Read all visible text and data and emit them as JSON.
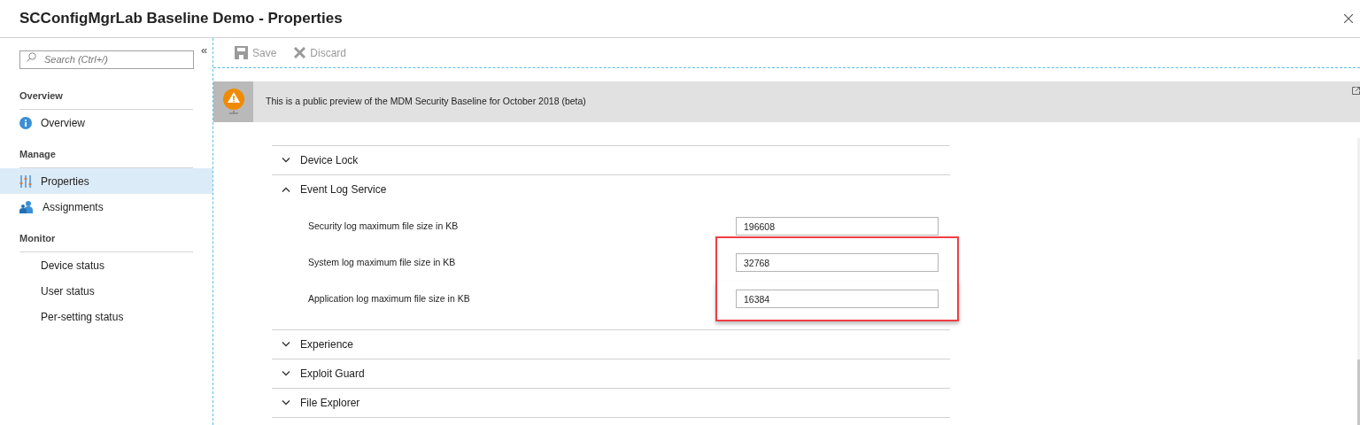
{
  "window": {
    "title": "SCConfigMgrLab Baseline Demo - Properties"
  },
  "sidebar": {
    "search": {
      "placeholder": "Search (Ctrl+/)"
    },
    "collapse_glyph": "«",
    "groups": [
      {
        "heading": "Overview",
        "items": [
          {
            "label": "Overview",
            "selected": false
          }
        ]
      },
      {
        "heading": "Manage",
        "items": [
          {
            "label": "Properties",
            "selected": true
          },
          {
            "label": "Assignments",
            "selected": false
          }
        ]
      },
      {
        "heading": "Monitor",
        "items": [
          {
            "label": "Device status",
            "selected": false
          },
          {
            "label": "User status",
            "selected": false
          },
          {
            "label": "Per-setting status",
            "selected": false
          }
        ]
      }
    ]
  },
  "toolbar": [
    {
      "label": "Save",
      "disabled": true
    },
    {
      "label": "Discard",
      "disabled": true
    }
  ],
  "banner": {
    "text": "This is a public preview of the MDM Security Baseline for October 2018 (beta)"
  },
  "sections": [
    {
      "title": "Device Lock",
      "expanded": false
    },
    {
      "title": "Event Log Service",
      "expanded": true,
      "settings": [
        {
          "label": "Security log maximum file size in KB",
          "value": "196608",
          "highlighted": false
        },
        {
          "label": "System log maximum file size in KB",
          "value": "32768",
          "highlighted": true
        },
        {
          "label": "Application log maximum file size in KB",
          "value": "16384",
          "highlighted": true
        }
      ]
    },
    {
      "title": "Experience",
      "expanded": false
    },
    {
      "title": "Exploit Guard",
      "expanded": false
    },
    {
      "title": "File Explorer",
      "expanded": false
    }
  ]
}
